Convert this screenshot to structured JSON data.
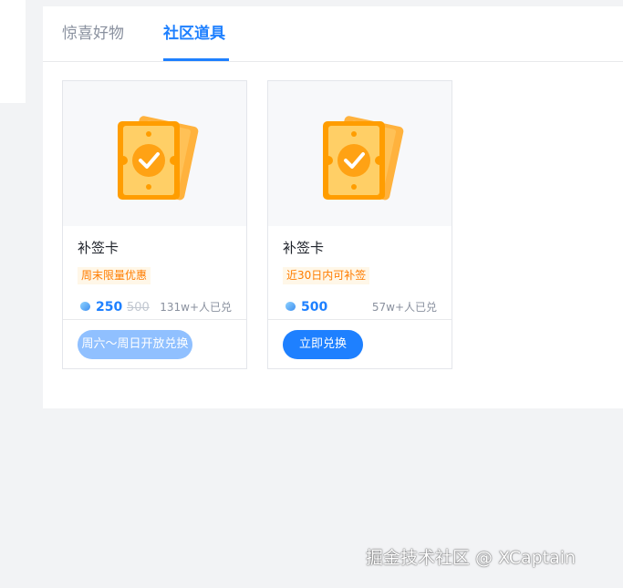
{
  "tabs": [
    {
      "label": "惊喜好物",
      "active": false
    },
    {
      "label": "社区道具",
      "active": true
    }
  ],
  "cards": [
    {
      "icon": "sign-card-icon",
      "title": "补签卡",
      "tag": "周末限量优惠",
      "price": "250",
      "original_price": "500",
      "sold": "131w+人已兑",
      "button": "周六～周日开放兑换",
      "button_enabled": false
    },
    {
      "icon": "sign-card-icon",
      "title": "补签卡",
      "tag": "近30日内可补签",
      "price": "500",
      "original_price": "",
      "sold": "57w+人已兑",
      "button": "立即兑换",
      "button_enabled": true
    }
  ],
  "watermark": "掘金技术社区 @ XCaptain",
  "colors": {
    "accent": "#1e80ff",
    "tag_text": "#ff7d00",
    "disabled_button": "#90c0ff"
  }
}
